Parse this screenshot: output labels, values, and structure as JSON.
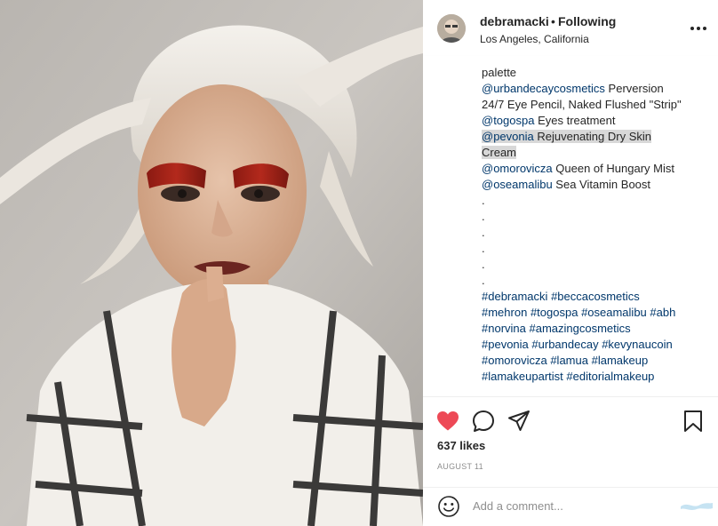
{
  "header": {
    "username": "debramacki",
    "separator": "•",
    "follow_status": "Following",
    "location": "Los Angeles, California",
    "more_icon": "more-horizontal-icon"
  },
  "caption_lines": [
    [
      {
        "t": "palette"
      }
    ],
    [
      {
        "t": "@urbandecaycosmetics",
        "m": true
      },
      {
        "t": " Perversion"
      }
    ],
    [
      {
        "t": "24/7 Eye Pencil, Naked Flushed \"Strip\""
      }
    ],
    [
      {
        "t": "@togospa",
        "m": true
      },
      {
        "t": " Eyes treatment"
      }
    ],
    [
      {
        "t": "@pevonia",
        "m": true,
        "h": true
      },
      {
        "t": " Rejuvenating Dry Skin",
        "h": true
      }
    ],
    [
      {
        "t": "Cream",
        "h": true
      }
    ],
    [
      {
        "t": "@omorovicza",
        "m": true
      },
      {
        "t": " Queen of Hungary Mist"
      }
    ],
    [
      {
        "t": "@oseamalibu",
        "m": true
      },
      {
        "t": " Sea Vitamin Boost"
      }
    ],
    [
      {
        "t": "."
      }
    ],
    [
      {
        "t": "."
      }
    ],
    [
      {
        "t": "."
      }
    ],
    [
      {
        "t": "."
      }
    ],
    [
      {
        "t": "."
      }
    ],
    [
      {
        "t": "."
      }
    ],
    [
      {
        "t": "#debramacki",
        "m": true
      },
      {
        "t": " "
      },
      {
        "t": "#beccacosmetics",
        "m": true
      }
    ],
    [
      {
        "t": "#mehron",
        "m": true
      },
      {
        "t": " "
      },
      {
        "t": "#togospa",
        "m": true
      },
      {
        "t": " "
      },
      {
        "t": "#oseamalibu",
        "m": true
      },
      {
        "t": " "
      },
      {
        "t": "#abh",
        "m": true
      }
    ],
    [
      {
        "t": "#norvina",
        "m": true
      },
      {
        "t": " "
      },
      {
        "t": "#amazingcosmetics",
        "m": true
      }
    ],
    [
      {
        "t": "#pevonia",
        "m": true
      },
      {
        "t": " "
      },
      {
        "t": "#urbandecay",
        "m": true
      },
      {
        "t": " "
      },
      {
        "t": "#kevynaucoin",
        "m": true
      }
    ],
    [
      {
        "t": "#omorovicza",
        "m": true
      },
      {
        "t": " "
      },
      {
        "t": "#lamua",
        "m": true
      },
      {
        "t": " "
      },
      {
        "t": "#lamakeup",
        "m": true
      }
    ],
    [
      {
        "t": "#lamakeupartist",
        "m": true
      },
      {
        "t": " "
      },
      {
        "t": "#editorialmakeup",
        "m": true
      }
    ]
  ],
  "actions": {
    "like_icon": "heart-filled-icon",
    "comment_icon": "comment-icon",
    "share_icon": "share-icon",
    "save_icon": "bookmark-icon",
    "like_color": "#ed4956"
  },
  "likes": "637 likes",
  "date": "AUGUST 11",
  "comment": {
    "placeholder": "Add a comment...",
    "emoji_icon": "emoji-icon"
  },
  "colors": {
    "mention": "#00376b",
    "text": "#262626",
    "muted": "#8e8e8e",
    "highlight": "#d8d8d8"
  }
}
